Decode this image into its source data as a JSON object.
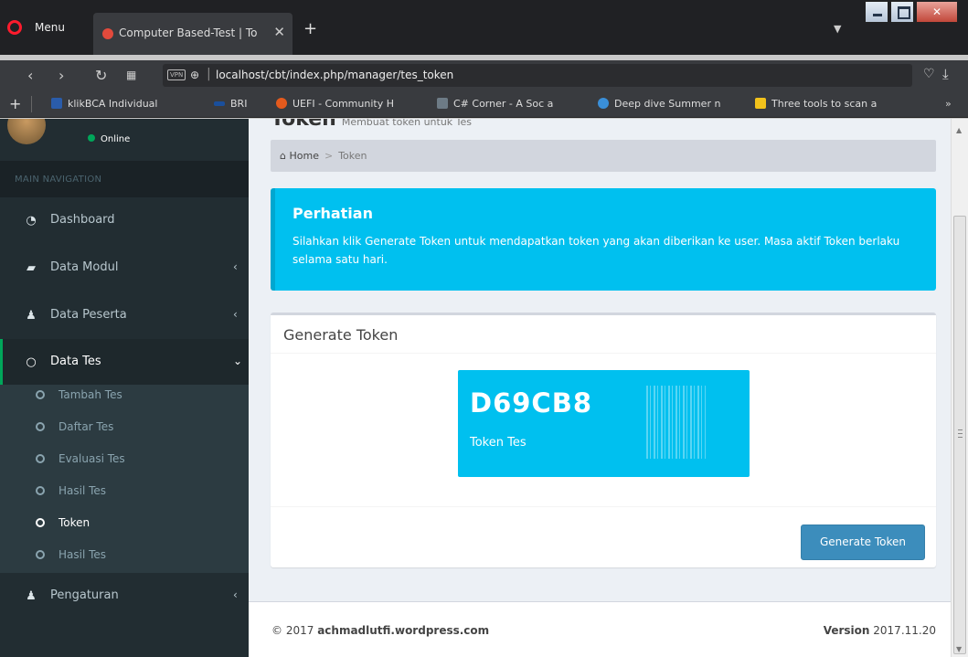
{
  "browser": {
    "menu_label": "Menu",
    "tab_title": "Computer Based-Test | To",
    "tab_close": "✕",
    "new_tab": "+",
    "url": "localhost/cbt/index.php/manager/tes_token",
    "vpn_label": "VPN",
    "bookmarks": [
      {
        "label": "klikBCA Individual",
        "color": "#2a5caa"
      },
      {
        "label": "BRI",
        "color": "#1a4f9c"
      },
      {
        "label": "UEFI - Community H",
        "color": "#e45a1d"
      },
      {
        "label": "C# Corner - A Soc a",
        "color": "#6d7b86"
      },
      {
        "label": "Deep dive Summer n",
        "color": "#3a8fd8"
      },
      {
        "label": "Three tools to scan a",
        "color": "#f2c21b"
      }
    ],
    "bookmarks_more": "»"
  },
  "sidebar": {
    "status": "Online",
    "nav_header": "MAIN NAVIGATION",
    "items": [
      {
        "label": "Dashboard",
        "icon": "dashboard-icon",
        "glyph": "◔"
      },
      {
        "label": "Data Modul",
        "icon": "book-icon",
        "glyph": "▰",
        "arrow": "‹"
      },
      {
        "label": "Data Peserta",
        "icon": "users-icon",
        "glyph": "♟",
        "arrow": "‹"
      },
      {
        "label": "Data Tes",
        "icon": "circle-icon",
        "glyph": "○",
        "arrow": "⌄"
      },
      {
        "label": "Pengaturan",
        "icon": "user-icon",
        "glyph": "♟",
        "arrow": "‹"
      }
    ],
    "sub_items": [
      {
        "label": "Tambah Tes"
      },
      {
        "label": "Daftar Tes"
      },
      {
        "label": "Evaluasi Tes"
      },
      {
        "label": "Hasil Tes"
      },
      {
        "label": "Token"
      },
      {
        "label": "Hasil Tes"
      }
    ]
  },
  "content": {
    "page_title": "Token",
    "page_subtitle": "Membuat token untuk Tes",
    "breadcrumb": {
      "home": "Home",
      "sep": ">",
      "current": "Token"
    },
    "callout": {
      "title": "Perhatian",
      "text": "Silahkan klik Generate Token untuk mendapatkan token yang akan diberikan ke user. Masa aktif Token berlaku selama satu hari."
    },
    "box": {
      "title": "Generate Token",
      "token_code": "D69CB8",
      "token_label": "Token Tes",
      "button_label": "Generate Token"
    },
    "footer": {
      "copyright_prefix": "© 2017",
      "copyright_site": "achmadlutfi.wordpress.com",
      "version_label": "Version",
      "version_value": "2017.11.20"
    }
  },
  "colors": {
    "sidebar_bg": "#222d32",
    "accent_green": "#00a65a",
    "info_blue": "#00c0ef",
    "primary_button": "#3c8dbc"
  }
}
